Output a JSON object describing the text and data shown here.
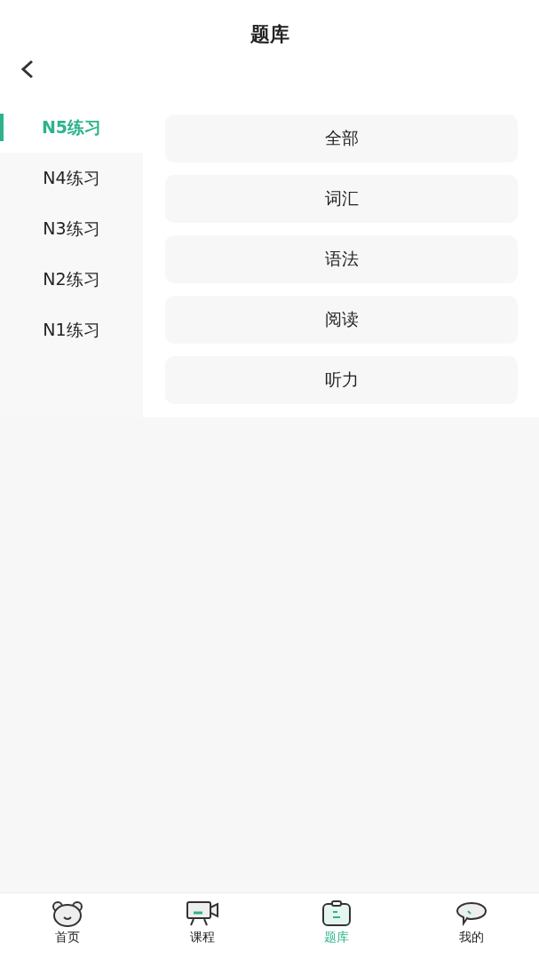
{
  "header": {
    "title": "题库"
  },
  "sidebar": {
    "items": [
      {
        "label": "N5练习",
        "selected": true
      },
      {
        "label": "N4练习",
        "selected": false
      },
      {
        "label": "N3练习",
        "selected": false
      },
      {
        "label": "N2练习",
        "selected": false
      },
      {
        "label": "N1练习",
        "selected": false
      }
    ]
  },
  "categories": [
    {
      "label": "全部"
    },
    {
      "label": "词汇"
    },
    {
      "label": "语法"
    },
    {
      "label": "阅读"
    },
    {
      "label": "听力"
    }
  ],
  "tab_bar": {
    "items": [
      {
        "kind": "bear",
        "label": "首页",
        "selected": false
      },
      {
        "kind": "camera",
        "label": "课程",
        "selected": false
      },
      {
        "kind": "clipboard",
        "label": "题库",
        "selected": true
      },
      {
        "kind": "chat",
        "label": "我的",
        "selected": false
      }
    ]
  }
}
